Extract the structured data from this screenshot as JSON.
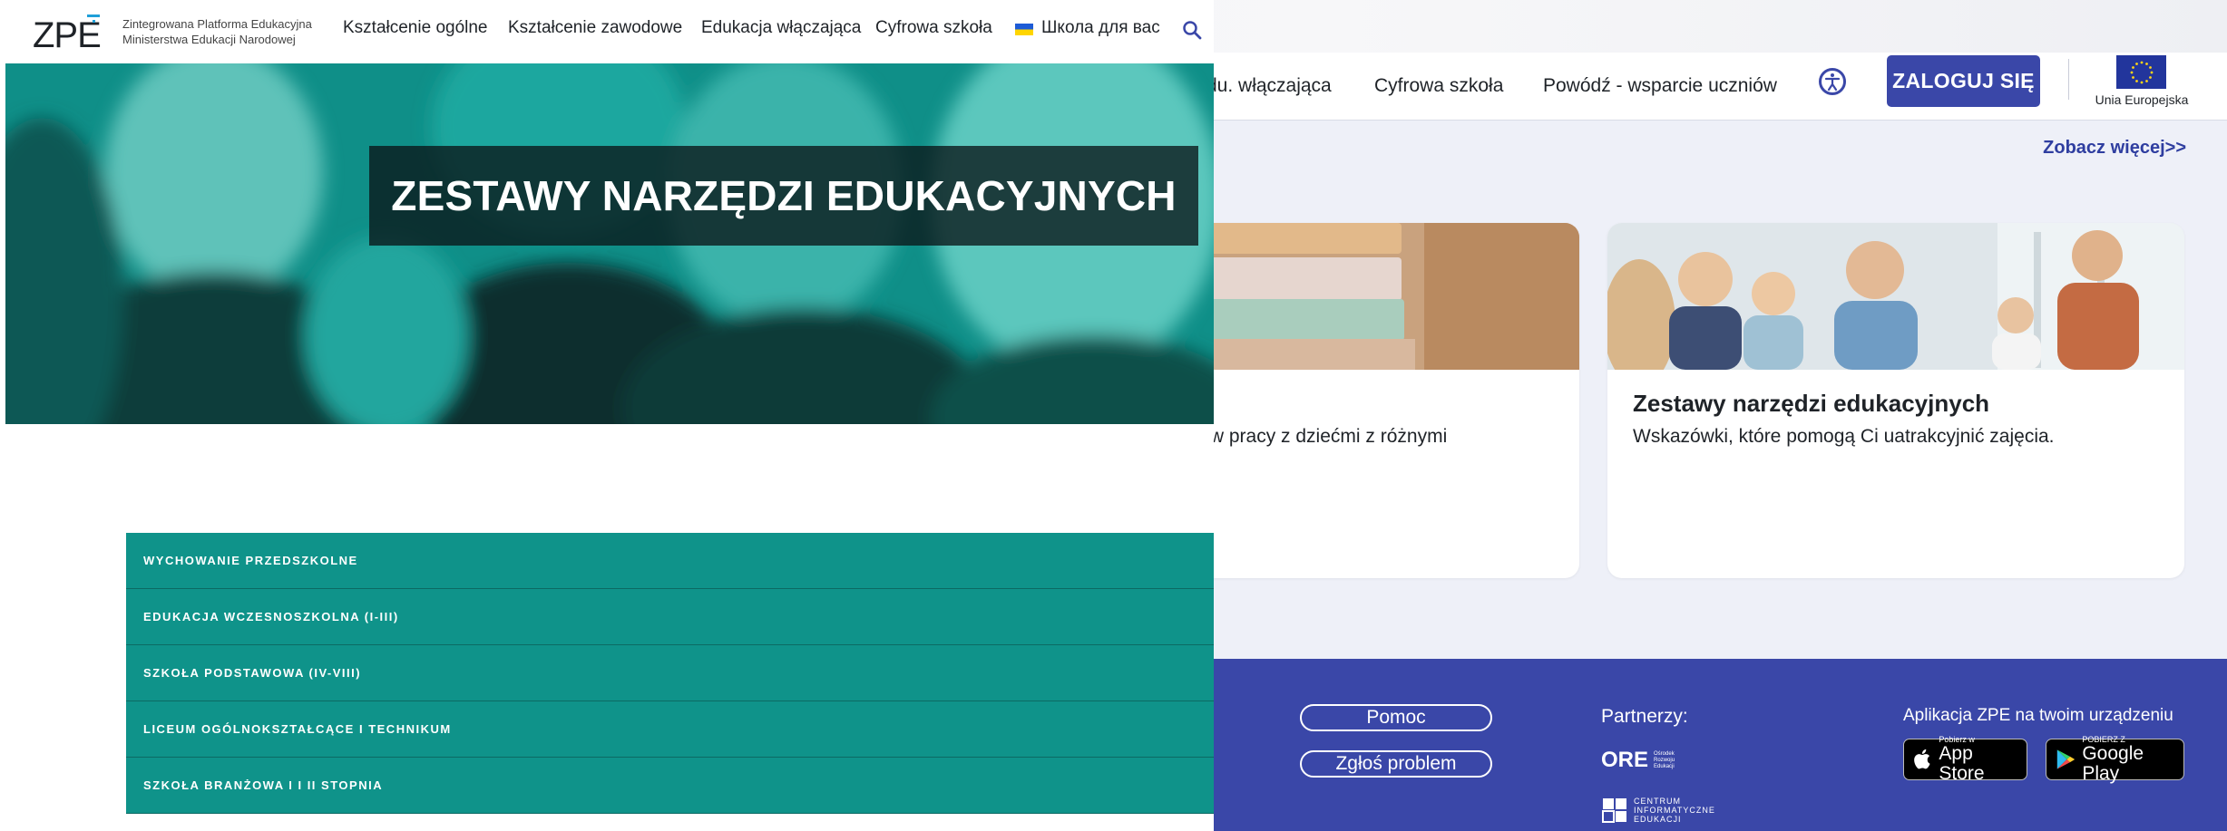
{
  "background_page": {
    "nav": {
      "items": [
        "du. włączająca",
        "Cyfrowa szkoła",
        "Powódź - wsparcie uczniów"
      ]
    },
    "login_label": "ZALOGUJ SIĘ",
    "eu_label": "Unia Europejska",
    "see_more": "Zobacz więcej>>",
    "cards": [
      {
        "title": "",
        "desc": "ela w pracy z dziećmi z różnymi"
      },
      {
        "title": "Zestawy narzędzi edukacyjnych",
        "desc": "Wskazówki, które pomogą Ci uatrakcyjnić zajęcia."
      }
    ],
    "footer": {
      "help": "Pomoc",
      "report": "Zgłoś problem",
      "partners_label": "Partnerzy:",
      "ore": "ORE",
      "ore_small": "Ośrodek Rozwoju Edukacji",
      "cie_small": "CENTRUM INFORMATYCZNE EDUKACJI",
      "app_label": "Aplikacja ZPE na twoim urządzeniu",
      "appstore_small": "Pobierz w",
      "appstore_big": "App Store",
      "gplay_small": "POBIERZ Z",
      "gplay_big": "Google Play"
    }
  },
  "foreground_page": {
    "logo": "ZPE",
    "logo_sub_1": "Zintegrowana Platforma Edukacyjna",
    "logo_sub_2": "Ministerstwa Edukacji Narodowej",
    "nav": [
      "Kształcenie ogólne",
      "Kształcenie zawodowe",
      "Edukacja włączająca",
      "Cyfrowa szkoła",
      "Школа для вас"
    ],
    "hero_title": "ZESTAWY NARZĘDZI EDUKACYJNYCH",
    "levels": [
      "WYCHOWANIE PRZEDSZKOLNE",
      "EDUKACJA WCZESNOSZKOLNA (I-III)",
      "SZKOŁA PODSTAWOWA (IV-VIII)",
      "LICEUM OGÓLNOKSZTAŁCĄCE I TECHNIKUM",
      "SZKOŁA BRANŻOWA I I II STOPNIA"
    ]
  },
  "colors": {
    "brand_blue": "#3a47a8",
    "teal": "#0f938a",
    "link_blue": "#2f3ea0"
  },
  "icons": [
    "search-icon",
    "accessibility-icon",
    "ukraine-flag-icon",
    "eu-flag-icon",
    "apple-icon",
    "google-play-icon"
  ]
}
